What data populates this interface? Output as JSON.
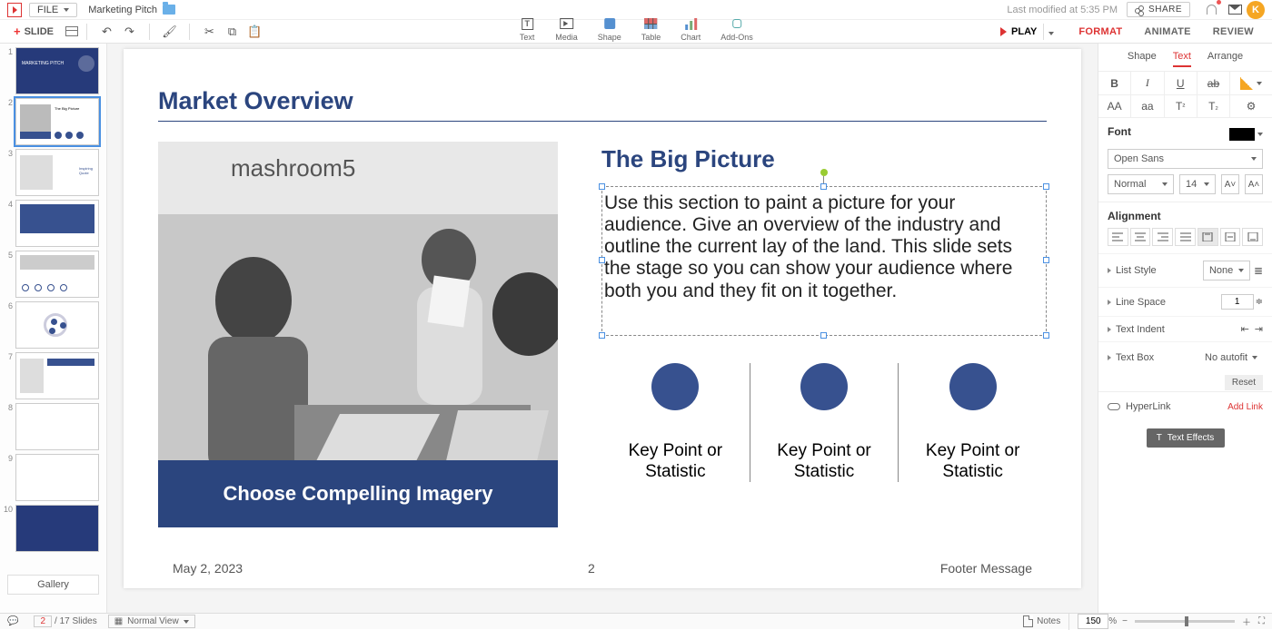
{
  "top": {
    "file_menu": "FILE",
    "doc_title": "Marketing Pitch",
    "last_modified": "Last modified at 5:35 PM",
    "share": "SHARE",
    "avatar_letter": "K"
  },
  "toolbar": {
    "slide_btn": "SLIDE",
    "play": "PLAY",
    "center": [
      {
        "label": "Text"
      },
      {
        "label": "Media"
      },
      {
        "label": "Shape"
      },
      {
        "label": "Table"
      },
      {
        "label": "Chart"
      },
      {
        "label": "Add-Ons"
      }
    ],
    "tabs": [
      "FORMAT",
      "ANIMATE",
      "REVIEW"
    ],
    "active_tab": "FORMAT"
  },
  "thumbs": {
    "gallery": "Gallery",
    "count": 10
  },
  "slide": {
    "title": "Market Overview",
    "image_caption": "Choose Compelling Imagery",
    "subheading": "The Big Picture",
    "body": "Use this section to paint a picture for your audience. Give an overview of the industry and outline the current lay of the land. This slide sets the stage so you can show your audience where both you and they fit on it together.",
    "kp_label": "Key Point or Statistic",
    "footer_date": "May 2, 2023",
    "footer_page": "2",
    "footer_msg": "Footer Message"
  },
  "panel": {
    "subtabs": [
      "Shape",
      "Text",
      "Arrange"
    ],
    "active_subtab": "Text",
    "font_heading": "Font",
    "font_family": "Open Sans",
    "font_weight": "Normal",
    "font_size": "14",
    "align_heading": "Alignment",
    "list_style": "List Style",
    "list_style_val": "None",
    "line_space": "Line Space",
    "line_space_val": "1",
    "text_indent": "Text Indent",
    "text_box": "Text Box",
    "text_box_val": "No autofit",
    "reset": "Reset",
    "hyperlink": "HyperLink",
    "add_link": "Add Link",
    "text_effects": "Text Effects"
  },
  "status": {
    "current": "2",
    "total": "/ 17 Slides",
    "view": "Normal View",
    "notes": "Notes",
    "zoom": "150",
    "pct": "%"
  }
}
